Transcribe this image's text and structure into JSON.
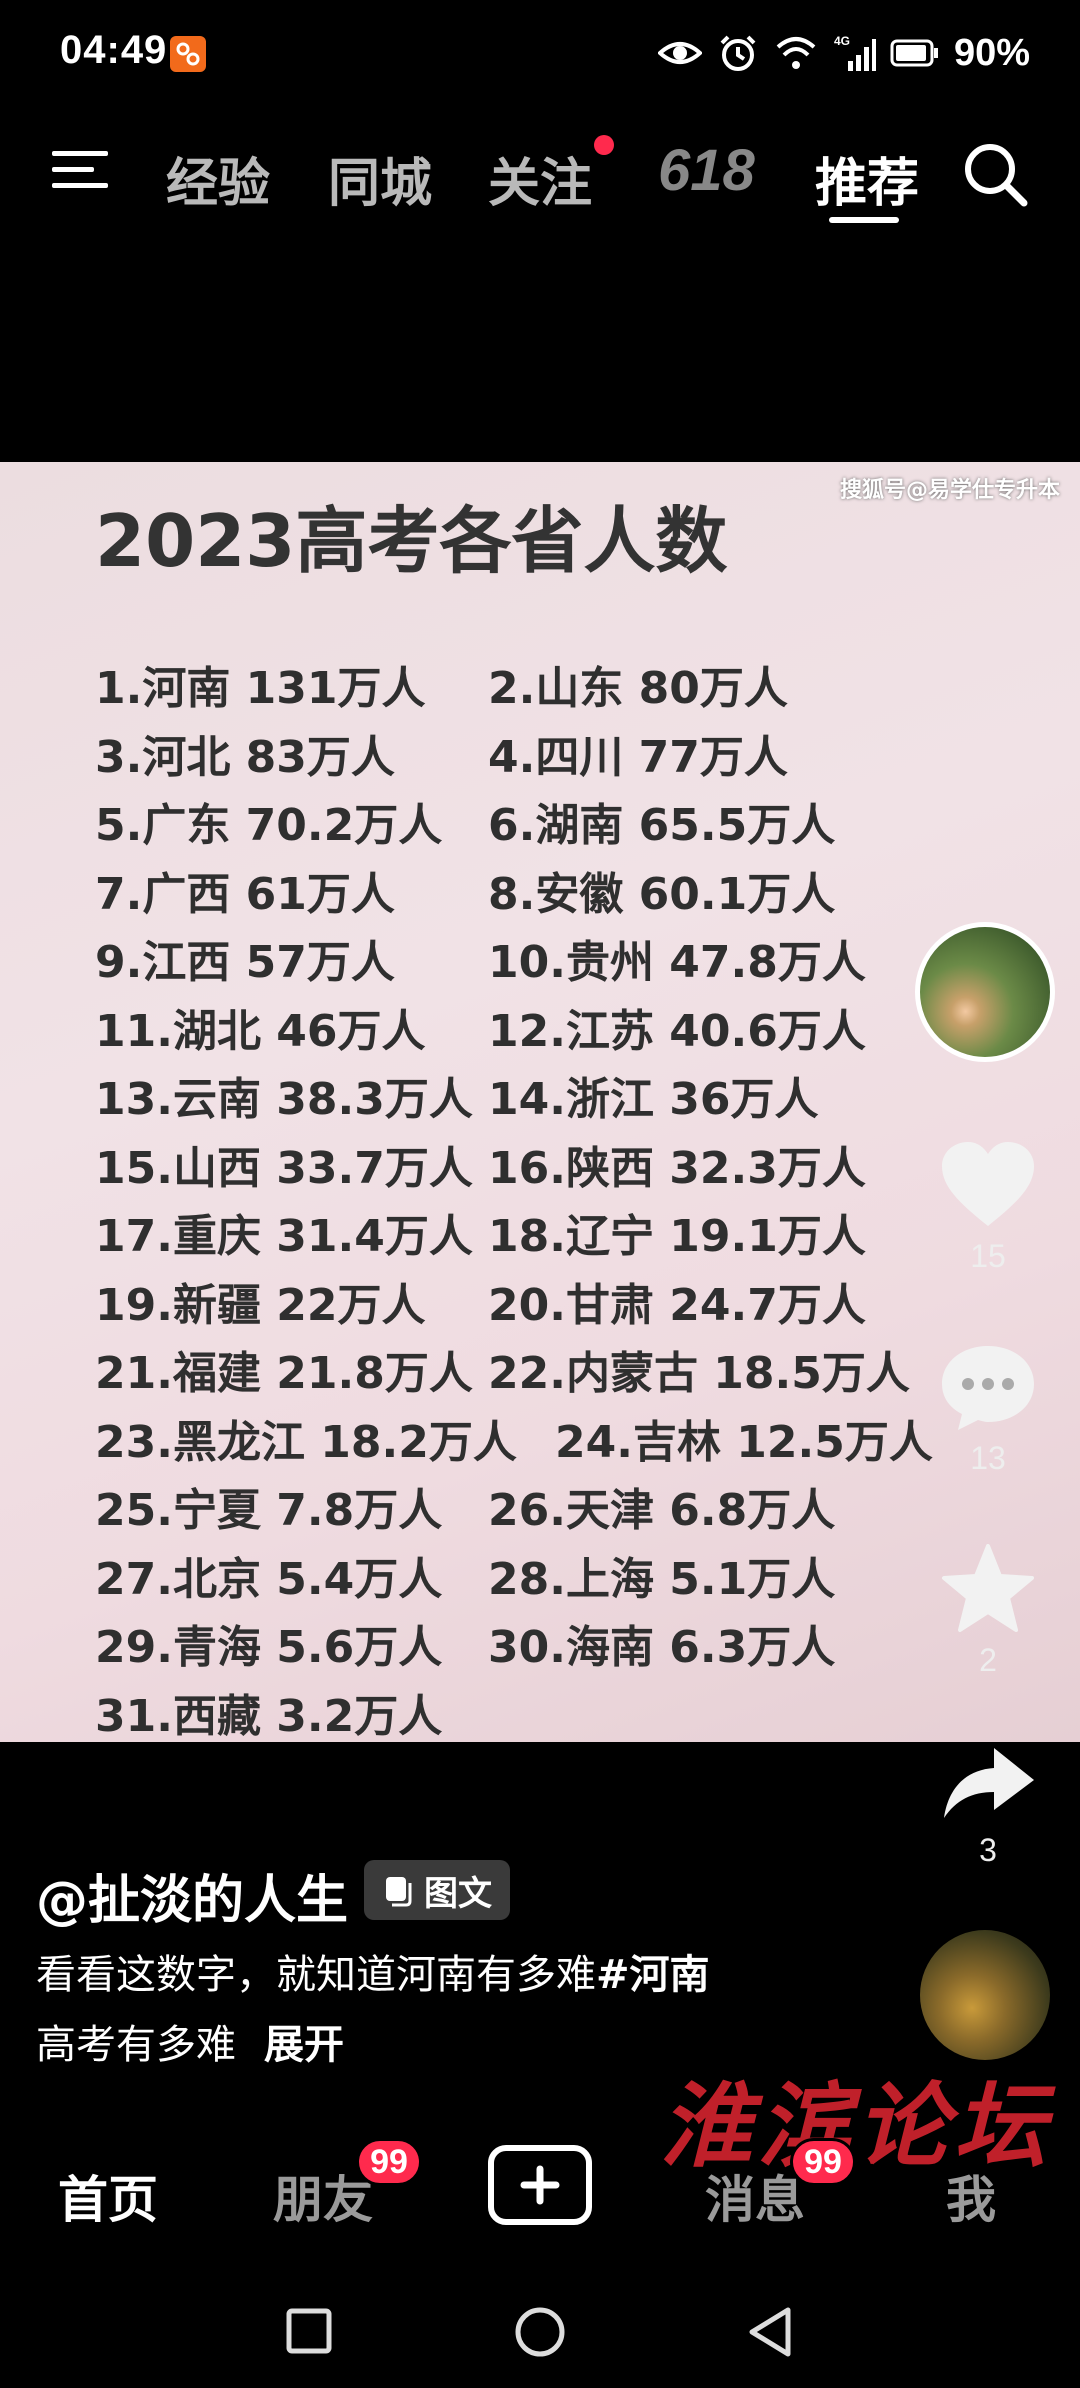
{
  "status_bar": {
    "time": "04:49",
    "battery": "90%",
    "network": "4G",
    "icons": [
      "app-notification-icon",
      "eye-icon",
      "alarm-icon",
      "wifi-icon",
      "signal-icon",
      "battery-icon"
    ]
  },
  "top_nav": {
    "tabs": [
      {
        "label": "经验",
        "active": false
      },
      {
        "label": "同城",
        "active": false
      },
      {
        "label": "关注",
        "active": false,
        "has_dot": true
      },
      {
        "label": "618",
        "active": false
      },
      {
        "label": "推荐",
        "active": true
      }
    ],
    "menu_icon": "menu-icon",
    "search_icon": "search-icon"
  },
  "post": {
    "watermark": "搜狐号@易学仕专升本",
    "title": "2023高考各省人数",
    "rows": [
      [
        "1.河南 131万人",
        "2.山东 80万人"
      ],
      [
        "3.河北 83万人",
        "4.四川 77万人"
      ],
      [
        "5.广东 70.2万人",
        "6.湖南 65.5万人"
      ],
      [
        "7.广西 61万人",
        "8.安徽 60.1万人"
      ],
      [
        "9.江西 57万人",
        "10.贵州 47.8万人"
      ],
      [
        "11.湖北 46万人",
        "12.江苏 40.6万人"
      ],
      [
        "13.云南 38.3万人",
        "14.浙江 36万人"
      ],
      [
        "15.山西 33.7万人",
        "16.陕西 32.3万人"
      ],
      [
        "17.重庆 31.4万人",
        "18.辽宁 19.1万人"
      ],
      [
        "19.新疆 22万人",
        "20.甘肃 24.7万人"
      ],
      [
        "21.福建 21.8万人",
        "22.内蒙古 18.5万人"
      ],
      [
        "23.黑龙江 18.2万人",
        "24.吉林 12.5万人"
      ],
      [
        "25.宁夏 7.8万人",
        "26.天津 6.8万人"
      ],
      [
        "27.北京 5.4万人",
        "28.上海 5.1万人"
      ],
      [
        "29.青海 5.6万人",
        "30.海南 6.3万人"
      ],
      [
        "31.西藏 3.2万人",
        ""
      ]
    ]
  },
  "actions": {
    "like_count": "15",
    "comment_count": "13",
    "favorite_count": "2",
    "share_count": "3"
  },
  "caption": {
    "author": "@扯淡的人生",
    "tag": "图文",
    "text": "看看这数字，就知道河南有多难",
    "hashtag_line1": "#河南",
    "hashtag_line2": "高考有多难",
    "expand": "展开"
  },
  "forum_watermark": "淮滨论坛",
  "bottom_nav": {
    "home": "首页",
    "friends": "朋友",
    "friends_badge": "99",
    "messages": "消息",
    "messages_badge": "99",
    "me": "我"
  },
  "colors": {
    "accent": "#ff2a4d",
    "background": "#000000",
    "forum_red": "#c0202a"
  }
}
